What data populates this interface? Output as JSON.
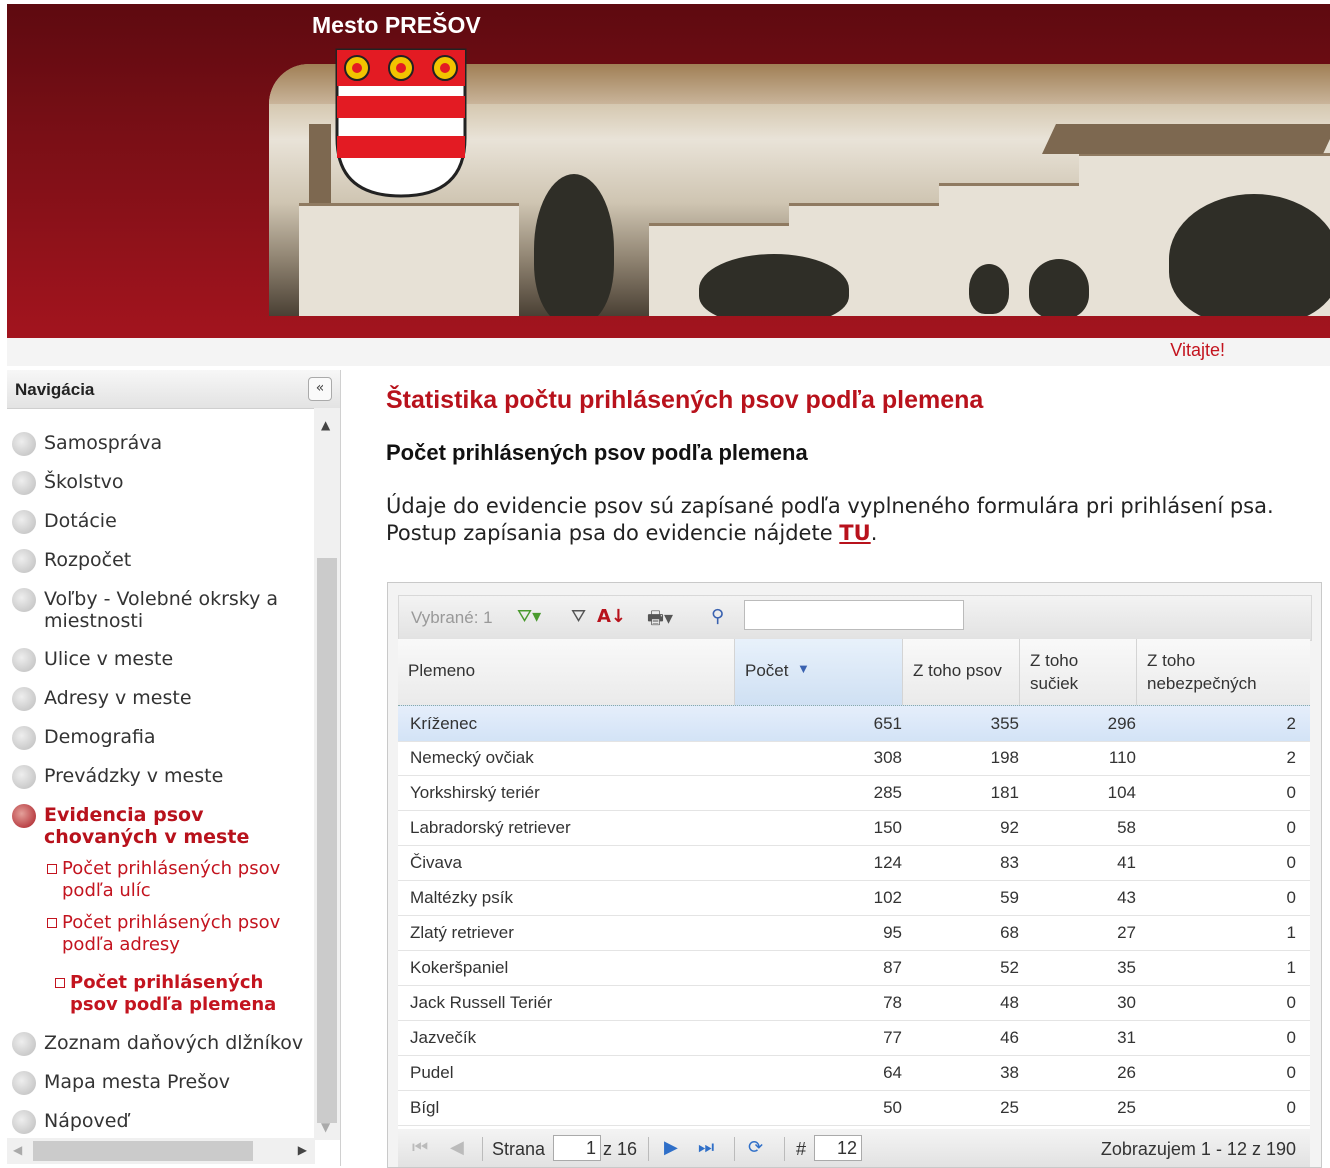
{
  "header": {
    "title": "Mesto PREŠOV",
    "welcome": "Vitajte!"
  },
  "nav": {
    "title": "Navigácia",
    "collapse_icon": "double-chevron-left-icon",
    "items": [
      {
        "label": "Samospráva"
      },
      {
        "label": "Školstvo"
      },
      {
        "label": "Dotácie"
      },
      {
        "label": "Rozpočet"
      },
      {
        "label": "Voľby - Volebné okrsky a miestnosti"
      },
      {
        "label": "Ulice v meste"
      },
      {
        "label": "Adresy v meste"
      },
      {
        "label": "Demografia"
      },
      {
        "label": "Prevádzky v meste"
      },
      {
        "label": "Evidencia psov chovaných v meste"
      },
      {
        "label": "Zoznam daňových dlžníkov"
      },
      {
        "label": "Mapa mesta Prešov"
      },
      {
        "label": "Nápoveď"
      }
    ],
    "subitems": [
      {
        "label": "Počet prihlásených psov podľa ulíc"
      },
      {
        "label": "Počet prihlásených psov podľa adresy"
      },
      {
        "label": "Počet prihlásených psov podľa plemena"
      }
    ]
  },
  "main": {
    "title": "Štatistika počtu prihlásených psov podľa plemena",
    "subtitle": "Počet prihlásených psov podľa plemena",
    "desc_line1": "Údaje do evidencie psov sú zapísané podľa vyplneného formulára pri prihlásení psa.",
    "desc_line2_pre": "Postup zapísania psa do evidencie nájdete ",
    "desc_link": "TU",
    "desc_line2_post": "."
  },
  "grid": {
    "selected_label": "Vybrané: 1",
    "search_value": "",
    "columns": [
      "Plemeno",
      "Počet",
      "Z toho psov",
      "Z toho sučiek",
      "Z toho nebezpečných"
    ],
    "rows": [
      [
        "Kríženec",
        "651",
        "355",
        "296",
        "2"
      ],
      [
        "Nemecký ovčiak",
        "308",
        "198",
        "110",
        "2"
      ],
      [
        "Yorkshirský teriér",
        "285",
        "181",
        "104",
        "0"
      ],
      [
        "Labradorský retriever",
        "150",
        "92",
        "58",
        "0"
      ],
      [
        "Čivava",
        "124",
        "83",
        "41",
        "0"
      ],
      [
        "Maltézky psík",
        "102",
        "59",
        "43",
        "0"
      ],
      [
        "Zlatý retriever",
        "95",
        "68",
        "27",
        "1"
      ],
      [
        "Kokeršpaniel",
        "87",
        "52",
        "35",
        "1"
      ],
      [
        "Jack Russell Teriér",
        "78",
        "48",
        "30",
        "0"
      ],
      [
        "Jazvečík",
        "77",
        "46",
        "31",
        "0"
      ],
      [
        "Pudel",
        "64",
        "38",
        "26",
        "0"
      ],
      [
        "Bígl",
        "50",
        "25",
        "25",
        "0"
      ]
    ],
    "pager": {
      "page_label": "Strana",
      "page_value": "1",
      "of_label": "z 16",
      "size_label": "#",
      "size_value": "12",
      "summary": "Zobrazujem 1 - 12 z 190"
    }
  }
}
